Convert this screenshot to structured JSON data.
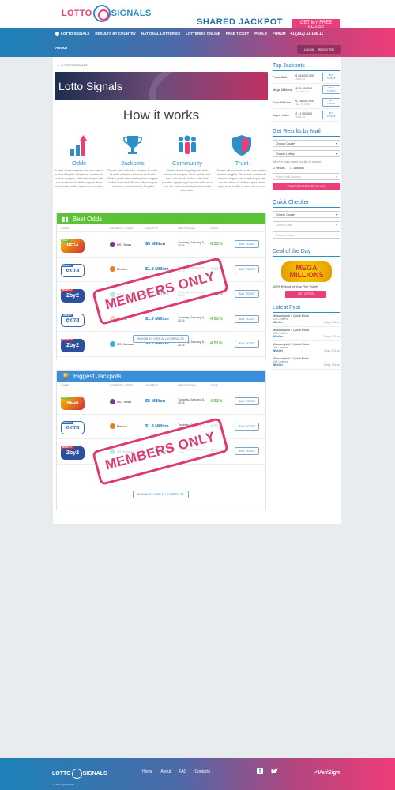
{
  "brand": {
    "logo_left": "LOTTO",
    "logo_right": "SIGNALS"
  },
  "header": {
    "shared_jackpot": "SHARED JACKPOT",
    "get_free_share": "GET MY FREE SHARE",
    "phone": "+1 (302) 31 136 11",
    "login": "LOGIN",
    "register": "REGISTER",
    "nav": [
      "LOTTO SIGNALS",
      "RESULTS BY COUNTRY",
      "NATIONAL LOTTERIES",
      "LOTTERIES ONLINE",
      "FREE TICKET",
      "POOLS",
      "FORUM"
    ],
    "about": "ABOUT"
  },
  "breadcrumb": "LOTTO SIGNALS",
  "hero_title": "Lotto Signals",
  "how_title": "How it works",
  "features": [
    {
      "title": "Odds",
      "desc": "Donec ullamcorper nulla non metus auctor fringilla. Praesent commodo cursus magna, vel scelerisque nisl consectetur et. Nullam quis risus eget urna mollis ornare vel eu leo."
    },
    {
      "title": "Jackpots",
      "desc": "Donec sed odio dui. Nullam id dolor id nibh ultricies vehicula ut id elit. Etiam porta sem malesuada magna mollis euismod. Donec ullamcorper nulla non metus auctor fringilla."
    },
    {
      "title": "Community",
      "desc": "Vestibulum id ligula porta felis euismod semper. Duis mollis, est non commodo luctus, nisi erat porttitor ligula, eget lacinia odio sem nec elit. Maecenas faucibus mollis interdum."
    },
    {
      "title": "Trust",
      "desc": "Donec ullamcorper nulla non metus auctor fringilla. Praesent commodo cursus magna, vel scelerisque nisl consectetur et. Nullam quis risus eget urna mollis ornare vel eu leo."
    }
  ],
  "best_odds": {
    "title": "Best Odds",
    "headers": [
      "GAME",
      "COUNTRY, STATE",
      "JACKPOT",
      "NEXT DRAW",
      "ODDS",
      ""
    ],
    "rows": [
      {
        "logo": "Mega Millions",
        "badge": "DAILY",
        "badge_color": "#5bc237",
        "country": "US, Texas",
        "jackpot": "$5 Million",
        "draw": "Tuesday, January 6, 2015",
        "odds": "4.51%",
        "btn": "BUY TICKET"
      },
      {
        "logo": "extra",
        "badge": "WEEKLY",
        "badge_color": "#2f6db3",
        "country": "Mexico",
        "jackpot": "$1.8 Million",
        "draw": "Tuesday, January 6, 2015",
        "odds": "4.51%",
        "btn": "BUY TICKET"
      },
      {
        "logo": "2by2",
        "badge": "MONTHLY",
        "badge_color": "#d6283b",
        "country": "US, Kansas",
        "jackpot": "$3.2 Million",
        "draw": "Tuesday, January 6, 2015",
        "odds": "4.51%",
        "btn": "BUY TICKET"
      },
      {
        "logo": "extra",
        "badge": "WEEKLY",
        "badge_color": "#2f6db3",
        "country": "Mexico",
        "jackpot": "$1.8 Million",
        "draw": "Tuesday, January 6, 2015",
        "odds": "4.51%",
        "btn": "BUY TICKET"
      },
      {
        "logo": "2by2",
        "badge": "MONTHLY",
        "badge_color": "#d6283b",
        "country": "US, Kansas",
        "jackpot": "$3.2 Million",
        "draw": "Tuesday, January 6, 2015",
        "odds": "4.51%",
        "btn": "BUY TICKET"
      }
    ],
    "members": "MEMBERS ONLY",
    "signin": "SIGN IN TO VIEW ALL 10 RESULTS"
  },
  "biggest_jackpots": {
    "title": "Biggest Jackpots",
    "headers": [
      "GAME",
      "COUNTRY, STATE",
      "JACKPOT",
      "NEXT DRAW",
      "ODDS",
      ""
    ],
    "rows": [
      {
        "logo": "Mega Millions",
        "badge": "DAILY",
        "badge_color": "#5bc237",
        "country": "US, Texas",
        "jackpot": "$5 Million",
        "draw": "Tuesday, January 6, 2015",
        "odds": "4.51%",
        "btn": "BUY TICKET"
      },
      {
        "logo": "extra",
        "badge": "WEEKLY",
        "badge_color": "#2f6db3",
        "country": "Mexico",
        "jackpot": "$1.8 Million",
        "draw": "Tuesday, January 6, 2015",
        "odds": "4.51%",
        "btn": "BUY TICKET"
      },
      {
        "logo": "2by2",
        "badge": "MONTHLY",
        "badge_color": "#d6283b",
        "country": "US, Kansas",
        "jackpot": "$3.2 Million",
        "draw": "Tuesday, January 6, 2015",
        "odds": "4.51%",
        "btn": "BUY TICKET"
      }
    ],
    "members": "MEMBERS ONLY",
    "signin": "SIGN IN TO VIEW ALL 10 RESULTS"
  },
  "top_jackpots": {
    "title": "Top Jackpots",
    "rows": [
      {
        "name": "PowerBall",
        "amount": "€ 261 000 000",
        "time": "1d 11:46",
        "btn": "BUY TICKET"
      },
      {
        "name": "Mega Millions",
        "amount": "$ 31 000 000",
        "time": "4d, 19:12:11",
        "btn": "BUY TICKET"
      },
      {
        "name": "Euro Millions",
        "amount": "€ 136 000 000",
        "time": "11d, 47:00:00",
        "btn": "BUY TICKET"
      },
      {
        "name": "Super Lotto",
        "amount": "£ 11 000 000",
        "time": "1d 11:46",
        "btn": "BUY TICKET"
      }
    ]
  },
  "results_mail": {
    "title": "Get Results by Mail",
    "country": "Choose Country",
    "lottery": "Choose Lottery",
    "question": "Which e-mails would you like to receive?",
    "opt1": "Results",
    "opt2": "Jackpots",
    "email_placeholder": "Enter Email Address",
    "btn": "CONFIRM REGISTER TO LIST"
  },
  "quick_checker": {
    "title": "Quick Checker",
    "country": "Choose Country",
    "date": "Choose Date",
    "lottery": "Choose Lottery"
  },
  "deal": {
    "title": "Deal of the Day",
    "logo": "MEGA MILLIONS",
    "text": "100% Refund on Your First Ticket!",
    "btn": "GET OFFER"
  },
  "latest_post": {
    "title": "Latest Post",
    "posts": [
      {
        "title": "Missouri pick 3 Quick Picks",
        "sub": "USA Lotteries",
        "who": "Wheller",
        "when": "Today, 8:11 am"
      },
      {
        "title": "Missouri pick 3 Quick Picks",
        "sub": "USA Lotteries",
        "who": "Wheller",
        "when": "Today, 8:11 am"
      },
      {
        "title": "Missouri pick 3 Quick Picks",
        "sub": "USA Lotteries",
        "who": "Wheller",
        "when": "Today, 8:11 am"
      },
      {
        "title": "Missouri pick 3 Quick Picks",
        "sub": "USA Lotteries",
        "who": "Wheller",
        "when": "Today, 8:11 am"
      }
    ]
  },
  "footer": {
    "links": [
      "Home",
      "About",
      "FAQ",
      "Contacts"
    ],
    "copyright": "© Lotto Signals 2015",
    "verisign": "VeriSign"
  }
}
